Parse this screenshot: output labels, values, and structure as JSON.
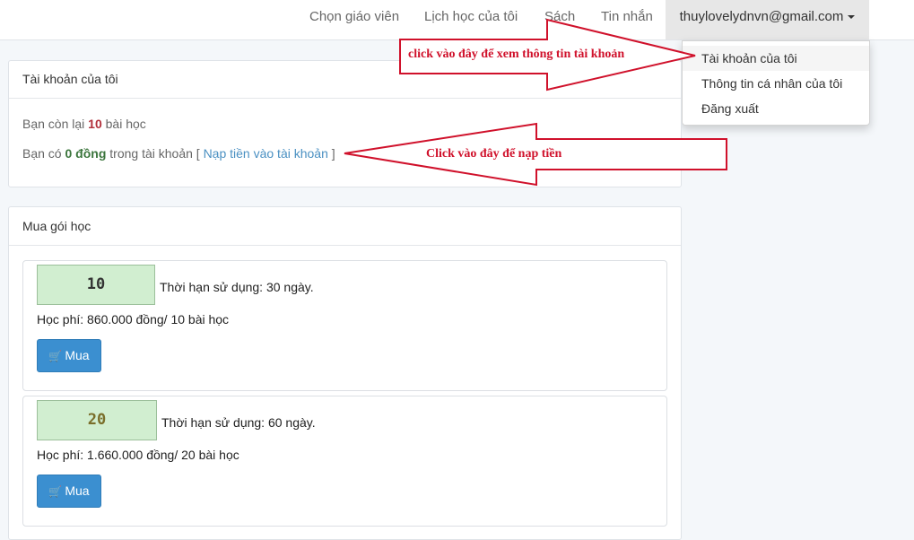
{
  "navbar": {
    "items": [
      "Chọn giáo viên",
      "Lịch học của tôi",
      "Sách",
      "Tin nhắn"
    ],
    "account_email": "thuylovelydnvn@gmail.com"
  },
  "dropdown": {
    "items": [
      "Tài khoản của tôi",
      "Thông tin cá nhân của tôi",
      "Đăng xuất"
    ]
  },
  "account_panel": {
    "title": "Tài khoản của tôi",
    "lessons_prefix": "Bạn còn lại",
    "lessons_count": "10",
    "lessons_suffix": "bài học",
    "balance_prefix": "Bạn có",
    "balance_amount": "0 đồng",
    "balance_suffix": "trong tài khoản [",
    "topup_link": "Nạp tiền vào tài khoản",
    "bracket_close": "]"
  },
  "packages_panel": {
    "title": "Mua gói học",
    "packages": [
      {
        "count": "10",
        "duration": "Thời hạn sử dụng: 30 ngày.",
        "fee": "Học phí: 860.000 đồng/ 10 bài học",
        "buy_label": "Mua"
      },
      {
        "count": "20",
        "duration": "Thời hạn sử dụng: 60 ngày.",
        "fee": "Học phí: 1.660.000 đồng/ 20 bài học",
        "buy_label": "Mua"
      }
    ]
  },
  "annotations": {
    "account_hint": "click vào đây để xem thông tin tài khoản",
    "topup_hint": "Click vào đây để nạp tiền"
  },
  "colors": {
    "accent": "#3b8fd0",
    "annotation": "#d0112b",
    "package_box": "#d1eed0",
    "package_10_text": "#333333",
    "package_20_text": "#7a6e2a"
  }
}
